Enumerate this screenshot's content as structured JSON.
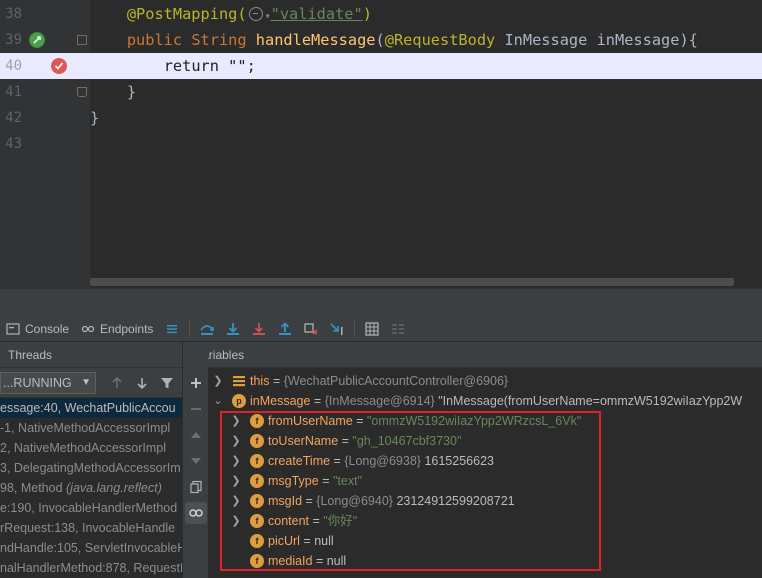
{
  "editor": {
    "lines": [
      {
        "num": "38",
        "kind": "annotation",
        "indent": "    ",
        "ann": "@PostMapping(",
        "val": "\"validate\"",
        "close": ")"
      },
      {
        "num": "39",
        "kind": "signature",
        "indent": "    ",
        "kw1": "public ",
        "type": "String ",
        "fn": "handleMessage",
        "open": "(",
        "ann": "@RequestBody ",
        "ptype": "InMessage ",
        "pname": "inMessage",
        "close": "){"
      },
      {
        "num": "40",
        "kind": "return",
        "indent": "        ",
        "kw": "return ",
        "str": "\"\"",
        "end": ";"
      },
      {
        "num": "41",
        "kind": "plain",
        "text": "    }"
      },
      {
        "num": "42",
        "kind": "plain",
        "text": "}"
      },
      {
        "num": "43",
        "kind": "plain",
        "text": ""
      }
    ]
  },
  "debug_toolbar": {
    "console_label": "Console",
    "endpoints_label": "Endpoints"
  },
  "threads": {
    "title": "Threads",
    "selector_value": "...RUNNING",
    "frames": [
      {
        "text": "essage:40, WechatPublicAccou",
        "selected": true
      },
      {
        "text": "-1, NativeMethodAccessorImpl",
        "pkg": ""
      },
      {
        "text": "2, NativeMethodAccessorImpl",
        "pkg": ""
      },
      {
        "text": "3, DelegatingMethodAccessorIm",
        "pkg": ""
      },
      {
        "text": "98, Method ",
        "pkg": "(java.lang.reflect)"
      },
      {
        "text": "e:190, InvocableHandlerMethod",
        "pkg": ""
      },
      {
        "text": "rRequest:138, InvocableHandle",
        "pkg": ""
      },
      {
        "text": "ndHandle:105, ServletInvocableH",
        "pkg": ""
      },
      {
        "text": "nalHandlerMethod:878, RequestM",
        "pkg": ""
      }
    ]
  },
  "variables": {
    "title": "Variables",
    "this_row": {
      "name": "this",
      "type": "{WechatPublicAccountController@6906}"
    },
    "param_row": {
      "name": "inMessage",
      "type": "{InMessage@6914}",
      "value": "\"InMessage(fromUserName=ommzW5192wiIazYpp2W"
    },
    "fields": [
      {
        "name": "fromUserName",
        "kind": "str",
        "value": "\"ommzW5192wiIazYpp2WRzcsL_6Vk\"",
        "expandable": true
      },
      {
        "name": "toUserName",
        "kind": "str",
        "value": "\"gh_10467cbf3730\"",
        "expandable": true
      },
      {
        "name": "createTime",
        "kind": "obj",
        "type": "{Long@6938}",
        "value": "1615256623",
        "expandable": true
      },
      {
        "name": "msgType",
        "kind": "str",
        "value": "\"text\"",
        "expandable": true
      },
      {
        "name": "msgId",
        "kind": "obj",
        "type": "{Long@6940}",
        "value": "23124912599208721",
        "expandable": true
      },
      {
        "name": "content",
        "kind": "str",
        "value": "\"你好\"",
        "expandable": true
      },
      {
        "name": "picUrl",
        "kind": "null",
        "value": "null",
        "expandable": false
      },
      {
        "name": "mediaId",
        "kind": "null",
        "value": "null",
        "expandable": false
      }
    ]
  },
  "colors": {
    "highlight_box": "#e0202a",
    "current_line": "#e9e9ff",
    "selected_frame": "#0d293e"
  }
}
